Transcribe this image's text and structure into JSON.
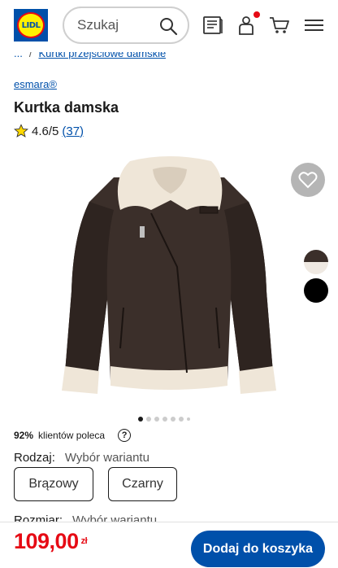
{
  "header": {
    "logo_text": "LIDL",
    "search_placeholder": "Szukaj"
  },
  "breadcrumb": {
    "ellipsis": "...",
    "separator": "/",
    "current": "Kurtki przejściowe damskie"
  },
  "product": {
    "brand": "esmara®",
    "title": "Kurtka damska",
    "rating": "4.6/5",
    "review_count": "(37)",
    "recommend_percent": "92%",
    "recommend_text": "klientów poleca",
    "help_symbol": "?",
    "color_label": "Rodzaj:",
    "color_hint": "Wybór wariantu",
    "colors": [
      "Brązowy",
      "Czarny"
    ],
    "size_label": "Rozmiar:",
    "size_hint": "Wybór wariantu",
    "swatches": [
      "#3b2f2a",
      "#000000"
    ],
    "image_dots": 7,
    "active_dot": 0
  },
  "footer": {
    "price": "109,00",
    "currency": "zł",
    "add_to_cart": "Dodaj do koszyka"
  },
  "colors": {
    "brand_blue": "#0050aa",
    "price_red": "#e60a14",
    "logo_yellow": "#fff000"
  }
}
